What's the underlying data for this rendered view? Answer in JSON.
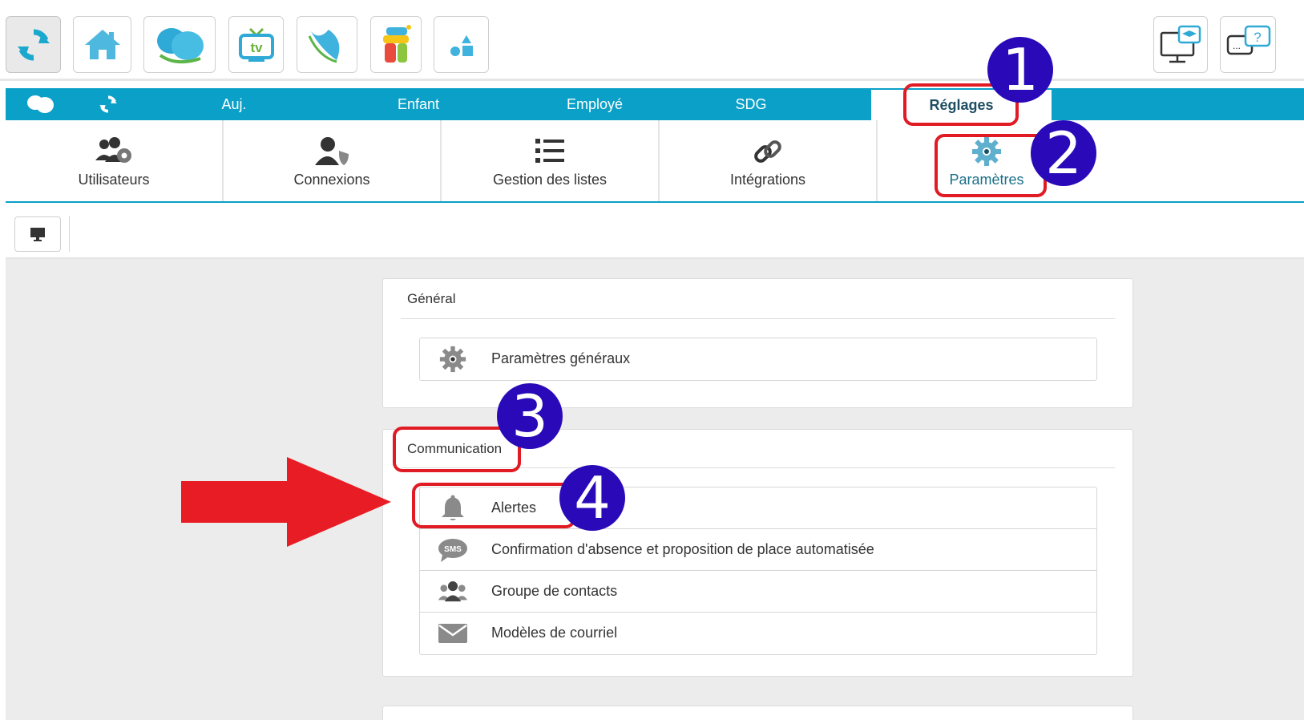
{
  "top_toolbar": {
    "buttons": [
      {
        "name": "refresh",
        "icon": "sync-icon"
      },
      {
        "name": "home",
        "icon": "house-icon"
      },
      {
        "name": "app-logo",
        "icon": "butterfly-logo-icon"
      },
      {
        "name": "tv",
        "icon": "tv-icon",
        "text": "tv"
      },
      {
        "name": "leaf",
        "icon": "leaf-logo-icon"
      },
      {
        "name": "kids-app",
        "icon": "colorful-character-icon"
      },
      {
        "name": "shapes",
        "icon": "shapes-icon"
      }
    ],
    "right_buttons": [
      {
        "name": "training",
        "icon": "monitor-graduation-icon"
      },
      {
        "name": "help-chat",
        "icon": "chat-question-icon",
        "text": "...?"
      }
    ]
  },
  "tabs": [
    {
      "label": "",
      "icon": "butterfly-icon"
    },
    {
      "label": "",
      "icon": "sync-icon"
    },
    {
      "label": "Auj."
    },
    {
      "label": "Enfant"
    },
    {
      "label": "Employé"
    },
    {
      "label": "SDG"
    },
    {
      "label": "Réglages",
      "active": true
    }
  ],
  "sub_nav": [
    {
      "label": "Utilisateurs",
      "icon": "users-gear-icon"
    },
    {
      "label": "Connexions",
      "icon": "user-shield-icon"
    },
    {
      "label": "Gestion des listes",
      "icon": "list-icon"
    },
    {
      "label": "Intégrations",
      "icon": "link-icon"
    },
    {
      "label": "Paramètres",
      "icon": "gear-icon",
      "active": true
    }
  ],
  "display_bar": {
    "icon": "monitor-icon"
  },
  "panels": {
    "general": {
      "title": "Général",
      "items": [
        {
          "label": "Paramètres généraux",
          "icon": "gear-icon"
        }
      ]
    },
    "communication": {
      "title": "Communication",
      "items": [
        {
          "label": "Alertes",
          "icon": "bell-icon"
        },
        {
          "label": "Confirmation d'absence et proposition de place automatisée",
          "icon": "sms-bubble-icon",
          "icon_text": "SMS"
        },
        {
          "label": "Groupe de contacts",
          "icon": "users-group-icon"
        },
        {
          "label": "Modèles de courriel",
          "icon": "envelope-icon"
        }
      ]
    }
  },
  "annotations": {
    "badges": [
      "1",
      "2",
      "3",
      "4"
    ],
    "colors": {
      "highlight": "#e01b24",
      "badge": "#2a0ab8",
      "arrow": "#e81c24"
    }
  },
  "colors": {
    "accent": "#0aa0c7",
    "active_text": "#1a6f89",
    "content_bg": "#ececec"
  }
}
